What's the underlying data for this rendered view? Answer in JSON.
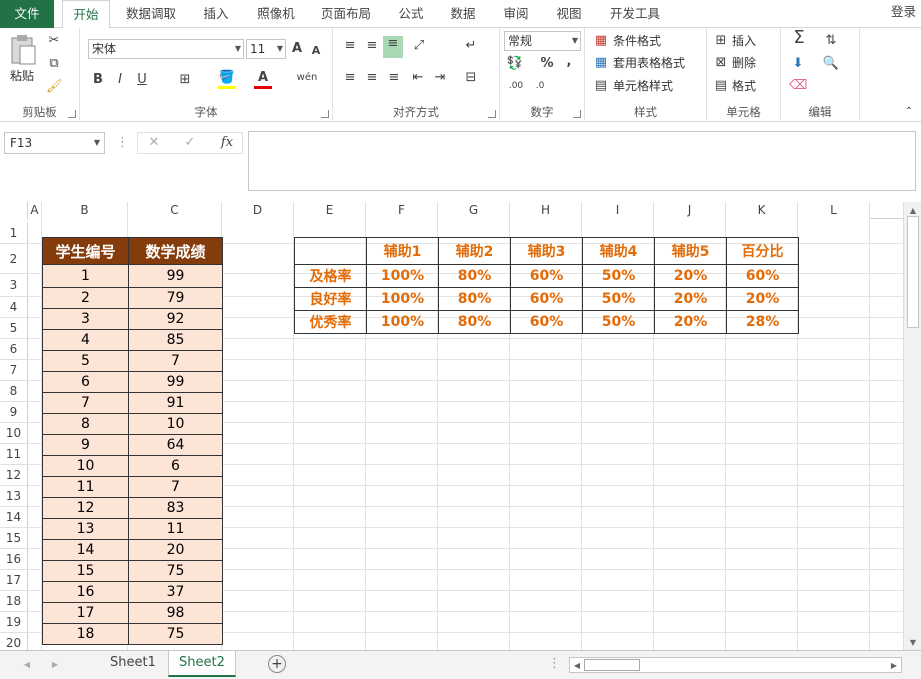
{
  "tabs": [
    {
      "label": "文件"
    },
    {
      "label": "开始"
    },
    {
      "label": "数据调取"
    },
    {
      "label": "插入"
    },
    {
      "label": "照像机"
    },
    {
      "label": "页面布局"
    },
    {
      "label": "公式"
    },
    {
      "label": "数据"
    },
    {
      "label": "审阅"
    },
    {
      "label": "视图"
    },
    {
      "label": "开发工具"
    }
  ],
  "login": "登录",
  "ribbon": {
    "clipboard": {
      "group_label": "剪贴板",
      "paste_label": "粘贴"
    },
    "font": {
      "group_label": "字体",
      "font_name": "宋体",
      "font_size": "11",
      "bold": "B",
      "italic": "I",
      "underline": "U",
      "grow": "A",
      "shrink": "A",
      "phonetic": "wén"
    },
    "alignment": {
      "group_label": "对齐方式"
    },
    "number": {
      "group_label": "数字",
      "format": "常规",
      "percent": "%",
      "comma": ","
    },
    "styles": {
      "group_label": "样式",
      "conditional": "条件格式",
      "table": "套用表格格式",
      "cell_styles": "单元格样式"
    },
    "cells": {
      "group_label": "单元格",
      "insert": "插入",
      "delete": "删除",
      "format": "格式"
    },
    "editing": {
      "group_label": "编辑"
    }
  },
  "formula_bar": {
    "name_box": "F13",
    "formula": ""
  },
  "columns": [
    "A",
    "B",
    "C",
    "D",
    "E",
    "F",
    "G",
    "H",
    "I",
    "J",
    "K",
    "L"
  ],
  "rows": [
    "1",
    "2",
    "3",
    "4",
    "5",
    "6",
    "7",
    "8",
    "9",
    "10",
    "11",
    "12",
    "13",
    "14",
    "15",
    "16",
    "17",
    "18",
    "19",
    "20"
  ],
  "table1": {
    "headers": [
      "学生编号",
      "数学成绩"
    ],
    "rows": [
      [
        "1",
        "99"
      ],
      [
        "2",
        "79"
      ],
      [
        "3",
        "92"
      ],
      [
        "4",
        "85"
      ],
      [
        "5",
        "7"
      ],
      [
        "6",
        "99"
      ],
      [
        "7",
        "91"
      ],
      [
        "8",
        "10"
      ],
      [
        "9",
        "64"
      ],
      [
        "10",
        "6"
      ],
      [
        "11",
        "7"
      ],
      [
        "12",
        "83"
      ],
      [
        "13",
        "11"
      ],
      [
        "14",
        "20"
      ],
      [
        "15",
        "75"
      ],
      [
        "16",
        "37"
      ],
      [
        "17",
        "98"
      ],
      [
        "18",
        "75"
      ]
    ]
  },
  "table2": {
    "headers": [
      "",
      "辅助1",
      "辅助2",
      "辅助3",
      "辅助4",
      "辅助5",
      "百分比"
    ],
    "rows": [
      [
        "及格率",
        "100%",
        "80%",
        "60%",
        "50%",
        "20%",
        "60%"
      ],
      [
        "良好率",
        "100%",
        "80%",
        "60%",
        "50%",
        "20%",
        "20%"
      ],
      [
        "优秀率",
        "100%",
        "80%",
        "60%",
        "50%",
        "20%",
        "28%"
      ]
    ]
  },
  "sheets": [
    {
      "label": "Sheet1"
    },
    {
      "label": "Sheet2"
    }
  ],
  "colors": {
    "accent": "#217346",
    "header_fill": "#843c0c",
    "body_fill": "#fce4d6",
    "pct_text": "#e36c09"
  }
}
